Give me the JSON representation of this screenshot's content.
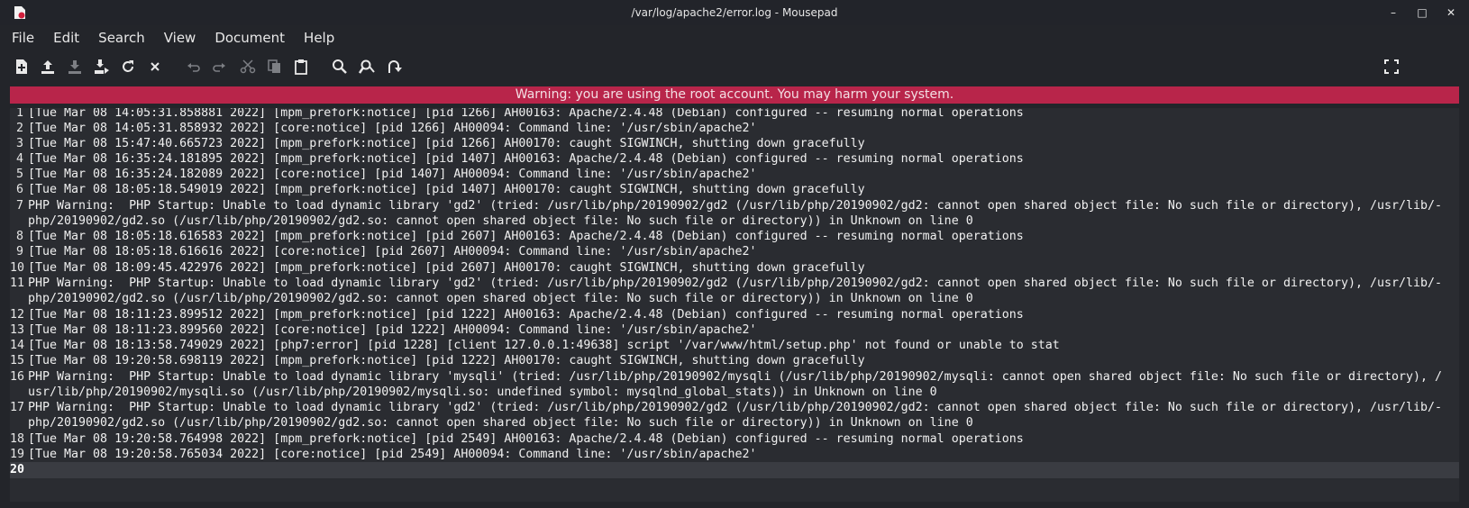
{
  "window": {
    "title": "/var/log/apache2/error.log - Mousepad",
    "minimize": "–",
    "maximize": "□",
    "close": "✕"
  },
  "menu": [
    "File",
    "Edit",
    "Search",
    "View",
    "Document",
    "Help"
  ],
  "toolbar": {
    "icons": [
      "new-document-icon",
      "open-icon",
      "save-icon",
      "save-as-icon",
      "reload-icon",
      "close-icon",
      "undo-icon",
      "redo-icon",
      "cut-icon",
      "copy-icon",
      "paste-icon",
      "find-icon",
      "find-replace-icon",
      "go-to-icon",
      "fullscreen-icon"
    ]
  },
  "warning": "Warning: you are using the root account. You may harm your system.",
  "lines": [
    {
      "n": "1",
      "t": "[Tue Mar 08 14:05:31.858881 2022] [mpm_prefork:notice] [pid 1266] AH00163: Apache/2.4.48 (Debian) configured -- resuming normal operations"
    },
    {
      "n": "2",
      "t": "[Tue Mar 08 14:05:31.858932 2022] [core:notice] [pid 1266] AH00094: Command line: '/usr/sbin/apache2'"
    },
    {
      "n": "3",
      "t": "[Tue Mar 08 15:47:40.665723 2022] [mpm_prefork:notice] [pid 1266] AH00170: caught SIGWINCH, shutting down gracefully"
    },
    {
      "n": "4",
      "t": "[Tue Mar 08 16:35:24.181895 2022] [mpm_prefork:notice] [pid 1407] AH00163: Apache/2.4.48 (Debian) configured -- resuming normal operations"
    },
    {
      "n": "5",
      "t": "[Tue Mar 08 16:35:24.182089 2022] [core:notice] [pid 1407] AH00094: Command line: '/usr/sbin/apache2'"
    },
    {
      "n": "6",
      "t": "[Tue Mar 08 18:05:18.549019 2022] [mpm_prefork:notice] [pid 1407] AH00170: caught SIGWINCH, shutting down gracefully"
    },
    {
      "n": "7",
      "t": "PHP Warning:  PHP Startup: Unable to load dynamic library 'gd2' (tried: /usr/lib/php/20190902/gd2 (/usr/lib/php/20190902/gd2: cannot open shared object file: No such file or directory), /usr/lib/-"
    },
    {
      "n": "",
      "t": "php/20190902/gd2.so (/usr/lib/php/20190902/gd2.so: cannot open shared object file: No such file or directory)) in Unknown on line 0"
    },
    {
      "n": "8",
      "t": "[Tue Mar 08 18:05:18.616583 2022] [mpm_prefork:notice] [pid 2607] AH00163: Apache/2.4.48 (Debian) configured -- resuming normal operations"
    },
    {
      "n": "9",
      "t": "[Tue Mar 08 18:05:18.616616 2022] [core:notice] [pid 2607] AH00094: Command line: '/usr/sbin/apache2'"
    },
    {
      "n": "10",
      "t": "[Tue Mar 08 18:09:45.422976 2022] [mpm_prefork:notice] [pid 2607] AH00170: caught SIGWINCH, shutting down gracefully"
    },
    {
      "n": "11",
      "t": "PHP Warning:  PHP Startup: Unable to load dynamic library 'gd2' (tried: /usr/lib/php/20190902/gd2 (/usr/lib/php/20190902/gd2: cannot open shared object file: No such file or directory), /usr/lib/-"
    },
    {
      "n": "",
      "t": "php/20190902/gd2.so (/usr/lib/php/20190902/gd2.so: cannot open shared object file: No such file or directory)) in Unknown on line 0"
    },
    {
      "n": "12",
      "t": "[Tue Mar 08 18:11:23.899512 2022] [mpm_prefork:notice] [pid 1222] AH00163: Apache/2.4.48 (Debian) configured -- resuming normal operations"
    },
    {
      "n": "13",
      "t": "[Tue Mar 08 18:11:23.899560 2022] [core:notice] [pid 1222] AH00094: Command line: '/usr/sbin/apache2'"
    },
    {
      "n": "14",
      "t": "[Tue Mar 08 18:13:58.749029 2022] [php7:error] [pid 1228] [client 127.0.0.1:49638] script '/var/www/html/setup.php' not found or unable to stat"
    },
    {
      "n": "15",
      "t": "[Tue Mar 08 19:20:58.698119 2022] [mpm_prefork:notice] [pid 1222] AH00170: caught SIGWINCH, shutting down gracefully"
    },
    {
      "n": "16",
      "t": "PHP Warning:  PHP Startup: Unable to load dynamic library 'mysqli' (tried: /usr/lib/php/20190902/mysqli (/usr/lib/php/20190902/mysqli: cannot open shared object file: No such file or directory), /"
    },
    {
      "n": "",
      "t": "usr/lib/php/20190902/mysqli.so (/usr/lib/php/20190902/mysqli.so: undefined symbol: mysqlnd_global_stats)) in Unknown on line 0"
    },
    {
      "n": "17",
      "t": "PHP Warning:  PHP Startup: Unable to load dynamic library 'gd2' (tried: /usr/lib/php/20190902/gd2 (/usr/lib/php/20190902/gd2: cannot open shared object file: No such file or directory), /usr/lib/-"
    },
    {
      "n": "",
      "t": "php/20190902/gd2.so (/usr/lib/php/20190902/gd2.so: cannot open shared object file: No such file or directory)) in Unknown on line 0"
    },
    {
      "n": "18",
      "t": "[Tue Mar 08 19:20:58.764998 2022] [mpm_prefork:notice] [pid 2549] AH00163: Apache/2.4.48 (Debian) configured -- resuming normal operations"
    },
    {
      "n": "19",
      "t": "[Tue Mar 08 19:20:58.765034 2022] [core:notice] [pid 2549] AH00094: Command line: '/usr/sbin/apache2'"
    },
    {
      "n": "20",
      "t": ""
    }
  ]
}
